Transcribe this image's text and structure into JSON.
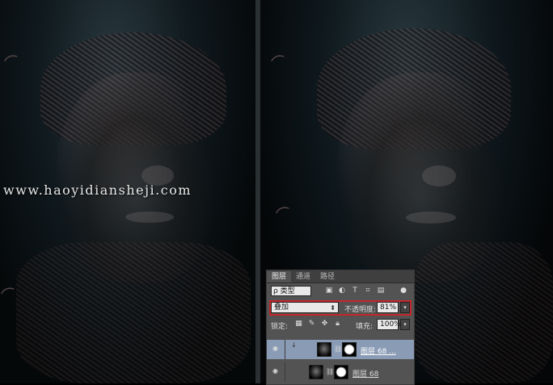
{
  "watermark": "www.haoyidiansheji.com",
  "layers_panel": {
    "tabs": [
      "图层",
      "通道",
      "路径"
    ],
    "filter": {
      "label": "ρ 类型"
    },
    "blend_mode": "叠加",
    "opacity_label": "不透明度:",
    "opacity_value": "81%",
    "lock_label": "锁定:",
    "fill_label": "填充:",
    "fill_value": "100%",
    "layers": [
      {
        "name": "图层 68 ...",
        "selected": true
      },
      {
        "name": "图层 68",
        "selected": false
      }
    ]
  },
  "colors": {
    "panel_bg": "#535353",
    "selected_layer": "#8a9bb5",
    "highlight_box": "#c3262a"
  }
}
